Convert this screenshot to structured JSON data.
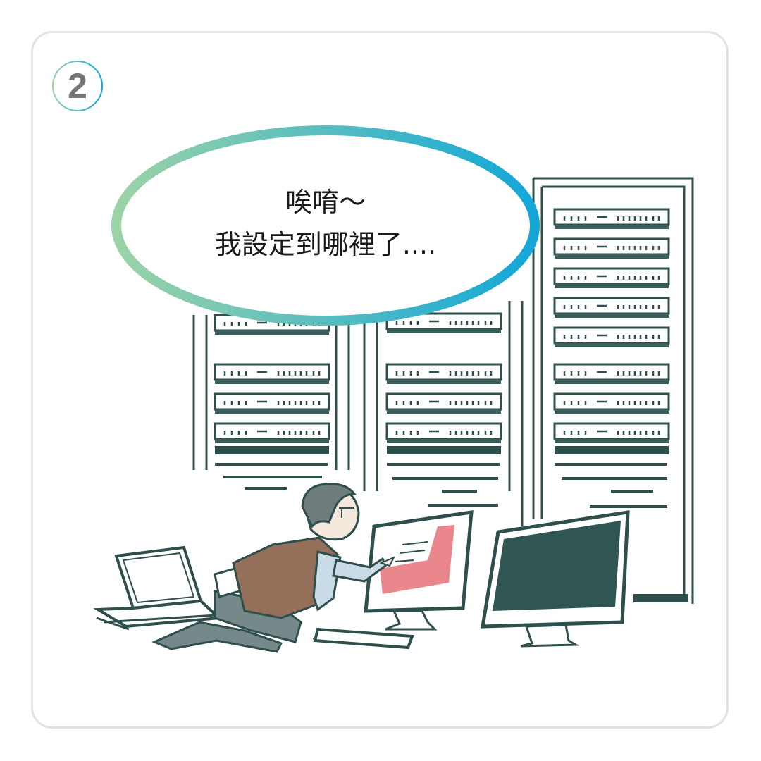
{
  "step": {
    "number": "2"
  },
  "speech_bubble": {
    "line1": "唉唷～",
    "line2": "我設定到哪裡了...."
  },
  "colors": {
    "panel_border": "#e2e2e2",
    "badge_number": "#757575",
    "bubble_gradient_start": "#9cd3a7",
    "bubble_gradient_end": "#12a7d8",
    "rack_outline": "#2f4f4c",
    "monitor_screen": "#2f5653",
    "screen_highlight": "#e9878d",
    "vest": "#94705a"
  },
  "icons": {
    "illustration": "server-room-worker-illustration"
  }
}
